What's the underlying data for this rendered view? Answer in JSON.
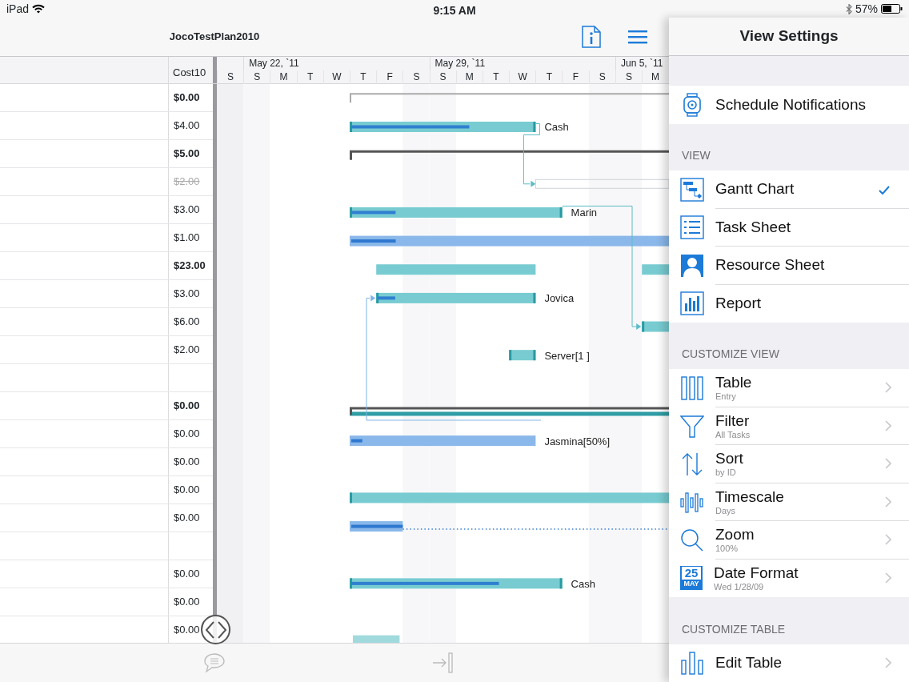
{
  "status_bar": {
    "device": "iPad",
    "time": "9:15 AM",
    "battery": "57%"
  },
  "document": {
    "title": "JocoTestPlan2010"
  },
  "grid": {
    "cost_column": "Cost10",
    "weeks": [
      {
        "label": "May 22, `11"
      },
      {
        "label": "May 29, `11"
      },
      {
        "label": "Jun 5, `11"
      }
    ],
    "days": [
      "S",
      "S",
      "M",
      "T",
      "W",
      "T",
      "F",
      "S",
      "S",
      "M",
      "T",
      "W",
      "T",
      "F",
      "S",
      "S",
      "M"
    ],
    "rows": [
      {
        "kind": "summary",
        "cost": "$0.00",
        "bar": {
          "kind": "project"
        }
      },
      {
        "kind": "task",
        "cost": "$4.00",
        "bar": {
          "kind": "task",
          "level": 0.64,
          "label": "Cash"
        }
      },
      {
        "kind": "summary",
        "cost": "$5.00",
        "bar": {
          "kind": "summary"
        }
      },
      {
        "kind": "inactive",
        "cost": "$2.00",
        "bar": {
          "kind": "inactive"
        }
      },
      {
        "kind": "task",
        "cost": "$3.00",
        "bar": {
          "kind": "task",
          "level": 0.21,
          "label": "Marin"
        }
      },
      {
        "kind": "task",
        "cost": "$1.00",
        "bar": {
          "kind": "assignment",
          "level": 0.14
        }
      },
      {
        "kind": "summary",
        "cost": "$23.00",
        "bar": {
          "kind": "split"
        }
      },
      {
        "kind": "task",
        "cost": "$3.00",
        "bar": {
          "kind": "task",
          "level": 0.11,
          "label": "Jovica"
        }
      },
      {
        "kind": "task",
        "cost": "$6.00",
        "bar": {
          "kind": "task"
        }
      },
      {
        "kind": "task",
        "cost": "$2.00",
        "bar": {
          "kind": "task",
          "label": "Server[1 ]"
        }
      },
      {
        "kind": "blank"
      },
      {
        "kind": "summary",
        "cost": "$0.00",
        "bar": {
          "kind": "summary_progress"
        }
      },
      {
        "kind": "task",
        "cost": "$0.00",
        "bar": {
          "kind": "assignment",
          "level": 0.06,
          "label": "Jasmina[50%]"
        }
      },
      {
        "kind": "task",
        "cost": "$0.00"
      },
      {
        "kind": "task",
        "cost": "$0.00",
        "bar": {
          "kind": "task"
        }
      },
      {
        "kind": "task",
        "cost": "$0.00",
        "bar": {
          "kind": "slipped",
          "level": 1
        }
      },
      {
        "kind": "blank"
      },
      {
        "kind": "task",
        "cost": "$0.00",
        "bar": {
          "kind": "task",
          "level": 0.7,
          "label": "Cash"
        }
      },
      {
        "kind": "task",
        "cost": "$0.00"
      },
      {
        "kind": "task",
        "cost": "$0.00",
        "bar": {
          "kind": "faded"
        }
      }
    ]
  },
  "settings_panel": {
    "title": "View Settings",
    "sections": [
      {
        "items": [
          {
            "kind": "plain",
            "title": "Schedule Notifications"
          }
        ]
      },
      {
        "header": "VIEW",
        "items": [
          {
            "kind": "option",
            "title": "Gantt Chart",
            "selected": true
          },
          {
            "kind": "option",
            "title": "Task Sheet",
            "selected": false
          },
          {
            "kind": "option",
            "title": "Resource Sheet",
            "selected": false
          },
          {
            "kind": "option",
            "title": "Report",
            "selected": false
          }
        ]
      },
      {
        "header": "CUSTOMIZE VIEW",
        "items": [
          {
            "kind": "disclosure",
            "title": "Table",
            "subtitle": "Entry"
          },
          {
            "kind": "disclosure",
            "title": "Filter",
            "subtitle": "All Tasks"
          },
          {
            "kind": "disclosure",
            "title": "Sort",
            "subtitle": "by ID"
          },
          {
            "kind": "disclosure",
            "title": "Timescale",
            "subtitle": "Days"
          },
          {
            "kind": "disclosure",
            "title": "Zoom",
            "subtitle": "100%"
          },
          {
            "kind": "disclosure",
            "title": "Date Format",
            "subtitle": "Wed 1/28/09",
            "calendar_day": "25",
            "calendar_month": "MAY"
          }
        ]
      },
      {
        "header": "CUSTOMIZE TABLE",
        "items": [
          {
            "kind": "disclosure",
            "title": "Edit Table"
          }
        ]
      }
    ]
  }
}
